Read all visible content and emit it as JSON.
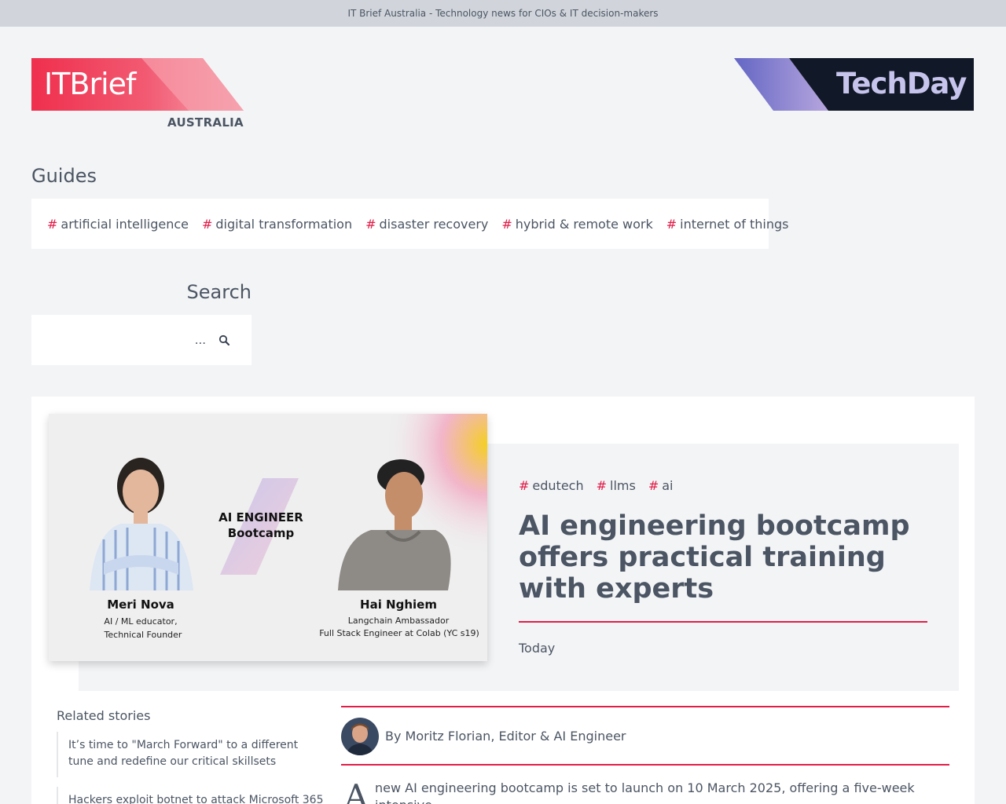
{
  "topbar": {
    "text": "IT Brief Australia - Technology news for CIOs & IT decision-makers"
  },
  "brand": {
    "logo_text": "ITBrief",
    "region": "AUSTRALIA",
    "partner_logo_text": "TechDay",
    "colors": {
      "accent": "#e11d48",
      "logo_red": "#ef2f4d",
      "logo_pink": "#f6a0ad",
      "techday_dark": "#111827",
      "techday_purple": "#8b86d6"
    }
  },
  "guides": {
    "heading": "Guides",
    "tags": [
      {
        "hash": "#",
        "label": "artificial intelligence"
      },
      {
        "hash": "#",
        "label": "digital transformation"
      },
      {
        "hash": "#",
        "label": "disaster recovery"
      },
      {
        "hash": "#",
        "label": "hybrid & remote work"
      },
      {
        "hash": "#",
        "label": "internet of things"
      }
    ]
  },
  "search": {
    "heading": "Search",
    "placeholder": "...",
    "icon": "search-icon"
  },
  "article": {
    "image": {
      "title_line1": "AI ENGINEER",
      "title_line2": "Bootcamp",
      "person1_name": "Meri Nova",
      "person1_role_line1": "AI / ML educator,",
      "person1_role_line2": "Technical Founder",
      "person2_name": "Hai Nghiem",
      "person2_role_line1": "Langchain Ambassador",
      "person2_role_line2": "Full Stack Engineer at Colab (YC s19)"
    },
    "tags": [
      {
        "hash": "#",
        "label": "edutech"
      },
      {
        "hash": "#",
        "label": "llms"
      },
      {
        "hash": "#",
        "label": "ai"
      }
    ],
    "headline": "AI engineering bootcamp offers practical training with experts",
    "date": "Today",
    "byline": "By Moritz Florian, Editor & AI Engineer",
    "dropcap": "A",
    "body": "new AI engineering bootcamp is set to launch on 10 March 2025, offering a five-week intensive"
  },
  "related": {
    "heading": "Related stories",
    "items": [
      {
        "title": "It’s time to \"March Forward\" to a different tune and redefine our critical skillsets"
      },
      {
        "title": "Hackers exploit botnet to attack Microsoft 365"
      }
    ]
  }
}
